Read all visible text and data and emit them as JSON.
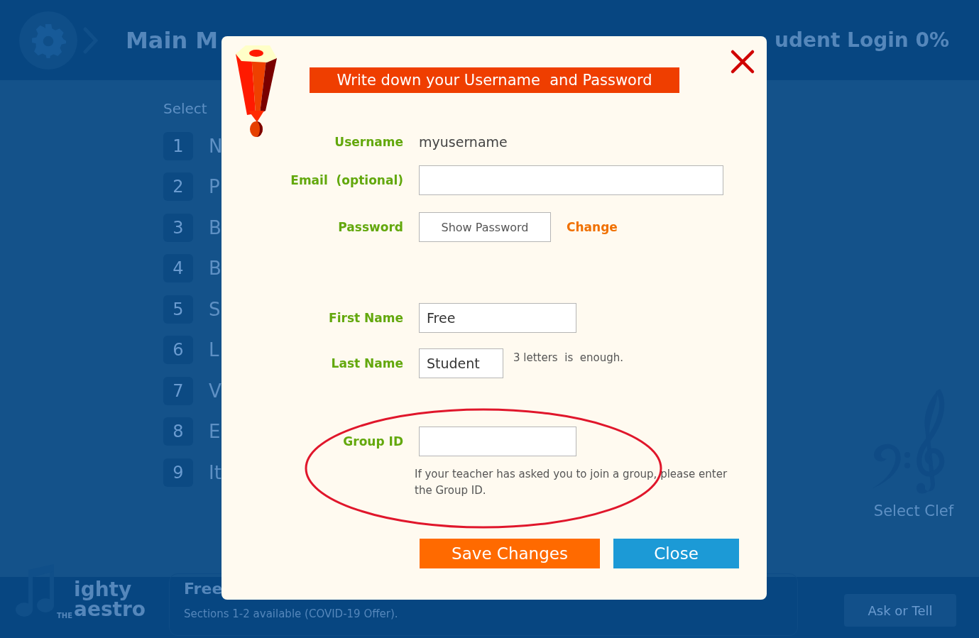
{
  "header": {
    "title": "Main M",
    "title_right": "udent Login 0%"
  },
  "section_heading": "Select",
  "sections": [
    {
      "number": "1",
      "label": "N"
    },
    {
      "number": "2",
      "label": "P"
    },
    {
      "number": "3",
      "label": "B"
    },
    {
      "number": "4",
      "label": "B"
    },
    {
      "number": "5",
      "label": "S"
    },
    {
      "number": "6",
      "label": "L"
    },
    {
      "number": "7",
      "label": "V"
    },
    {
      "number": "8",
      "label": "E"
    },
    {
      "number": "9",
      "label": "It"
    }
  ],
  "clef_label": "Select Clef",
  "logo": {
    "badge": "THE",
    "line_1": "ighty",
    "line_2": "aestro"
  },
  "plan": {
    "title": "Free",
    "note": "Sections 1-2 available (COVID-19 Offer)."
  },
  "ask_button": "Ask or Tell",
  "dialog": {
    "banner": "Write down your Username  and Password",
    "fields": [
      {
        "kind": "static",
        "label": "Username",
        "value": "myusername"
      },
      {
        "kind": "input",
        "label": "Email  (optional)"
      },
      {
        "kind": "password",
        "label": "Password",
        "button": "Show Password",
        "link": "Change"
      },
      {
        "kind": "input",
        "label": "First Name",
        "value": "Free"
      },
      {
        "kind": "input",
        "label": "Last Name",
        "value": "Student",
        "hint": "3 letters  is  enough."
      },
      {
        "kind": "input",
        "label": "Group ID",
        "help": "If your teacher has asked you to join a group, please enter the Group ID."
      }
    ],
    "buttons": [
      {
        "kind": "save",
        "label": "Save Changes"
      },
      {
        "kind": "close",
        "label": "Close"
      }
    ]
  }
}
